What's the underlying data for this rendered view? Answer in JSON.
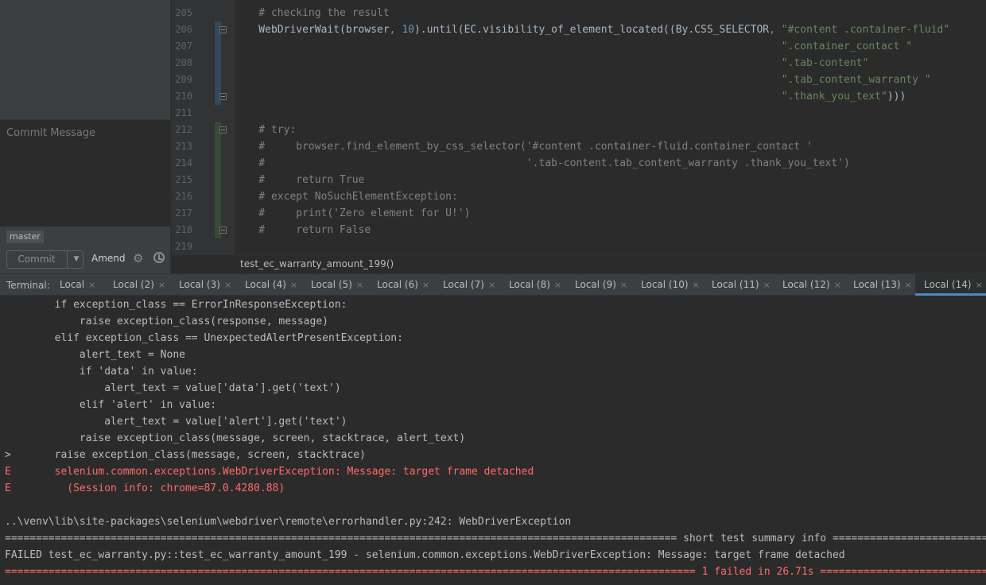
{
  "commit_panel": {
    "commit_message_placeholder": "Commit Message",
    "branch": "master",
    "commit_button": "Commit",
    "amend_label": "Amend",
    "dropdown_glyph": "▼",
    "gear_glyph": "⚙"
  },
  "editor": {
    "lines": [
      {
        "num": "205",
        "code": "    # checking the result"
      },
      {
        "num": "206",
        "code": "    WebDriverWait(browser, 10).until(EC.visibility_of_element_located((By.CSS_SELECTOR, \"#content .container-fluid\""
      },
      {
        "num": "207",
        "code": "                                                                                        \".container_contact \""
      },
      {
        "num": "208",
        "code": "                                                                                        \".tab-content\""
      },
      {
        "num": "209",
        "code": "                                                                                        \".tab_content_warranty \""
      },
      {
        "num": "210",
        "code": "                                                                                        \".thank_you_text\")))"
      },
      {
        "num": "211",
        "code": ""
      },
      {
        "num": "212",
        "code": "    # try:"
      },
      {
        "num": "213",
        "code": "    #     browser.find_element_by_css_selector('#content .container-fluid.container_contact '"
      },
      {
        "num": "214",
        "code": "    #                                          '.tab-content.tab_content_warranty .thank_you_text')"
      },
      {
        "num": "215",
        "code": "    #     return True"
      },
      {
        "num": "216",
        "code": "    # except NoSuchElementException:"
      },
      {
        "num": "217",
        "code": "    #     print('Zero element for U!')"
      },
      {
        "num": "218",
        "code": "    #     return False"
      },
      {
        "num": "219",
        "code": ""
      }
    ],
    "breadcrumb": "test_ec_warranty_amount_199()"
  },
  "terminal": {
    "label": "Terminal:",
    "tabs": [
      "Local",
      "Local (2)",
      "Local (3)",
      "Local (4)",
      "Local (5)",
      "Local (6)",
      "Local (7)",
      "Local (8)",
      "Local (9)",
      "Local (10)",
      "Local (11)",
      "Local (12)",
      "Local (13)",
      "Local (14)"
    ],
    "close_glyph": "×",
    "lines": [
      {
        "text": "        if exception_class == ErrorInResponseException:",
        "kind": "normal"
      },
      {
        "text": "            raise exception_class(response, message)",
        "kind": "normal"
      },
      {
        "text": "        elif exception_class == UnexpectedAlertPresentException:",
        "kind": "normal"
      },
      {
        "text": "            alert_text = None",
        "kind": "normal"
      },
      {
        "text": "            if 'data' in value:",
        "kind": "normal"
      },
      {
        "text": "                alert_text = value['data'].get('text')",
        "kind": "normal"
      },
      {
        "text": "            elif 'alert' in value:",
        "kind": "normal"
      },
      {
        "text": "                alert_text = value['alert'].get('text')",
        "kind": "normal"
      },
      {
        "text": "            raise exception_class(message, screen, stacktrace, alert_text)",
        "kind": "normal"
      },
      {
        "text": ">       raise exception_class(message, screen, stacktrace)",
        "kind": "normal"
      },
      {
        "text": "E       selenium.common.exceptions.WebDriverException: Message: target frame detached",
        "kind": "err"
      },
      {
        "text": "E         (Session info: chrome=87.0.4280.88)",
        "kind": "err"
      },
      {
        "text": "",
        "kind": "normal"
      },
      {
        "text": "..\\venv\\lib\\site-packages\\selenium\\webdriver\\remote\\errorhandler.py:242: WebDriverException",
        "kind": "normal"
      },
      {
        "text": "============================================================================================================ short test summary info ============================================================================================================",
        "kind": "normal"
      },
      {
        "text": "FAILED test_ec_warranty.py::test_ec_warranty_amount_199 - selenium.common.exceptions.WebDriverException: Message: target frame detached",
        "kind": "normal"
      },
      {
        "text": "=============================================================================================================== 1 failed in 26.71s ================================================================================================================",
        "kind": "err"
      }
    ]
  }
}
